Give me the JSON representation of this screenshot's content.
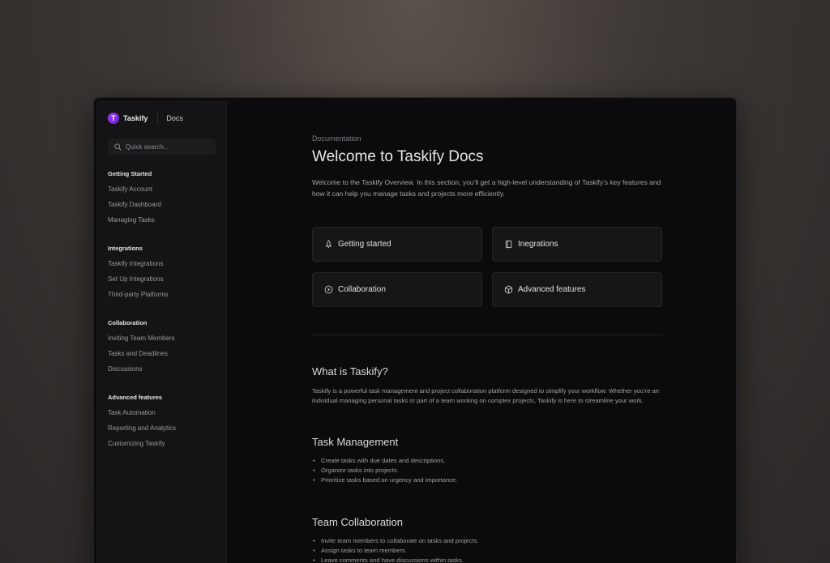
{
  "brand": {
    "name": "Taskify",
    "logo_letter": "T",
    "docs_label": "Docs"
  },
  "search": {
    "placeholder": "Quick search..."
  },
  "sidebar": {
    "groups": [
      {
        "heading": "Getting Started",
        "items": [
          "Taskify Account",
          "Taskify Dashboard",
          "Managing Tasks"
        ]
      },
      {
        "heading": "Integrations",
        "items": [
          "Taskify Integrations",
          "Set Up Integrations",
          "Third-party Platforms"
        ]
      },
      {
        "heading": "Collaboration",
        "items": [
          "Inviting Team Members",
          "Tasks and Deadlines",
          "Discussions"
        ]
      },
      {
        "heading": "Advanced features",
        "items": [
          "Task Automation",
          "Reporting and Analytics",
          "Customizing Taskify"
        ]
      }
    ]
  },
  "main": {
    "eyebrow": "Documentation",
    "title": "Welcome to Taskify Docs",
    "intro": "Welcome to the Taskify Overview. In this section, you’ll get a high-level understanding of Taskify’s key features and how it can help you manage tasks and projects more efficiently.",
    "cards": [
      {
        "label": "Getting started",
        "icon": "rocket-icon"
      },
      {
        "label": "Inegrations",
        "icon": "book-icon"
      },
      {
        "label": "Collaboration",
        "icon": "play-circle-icon"
      },
      {
        "label": "Advanced features",
        "icon": "cube-icon"
      }
    ],
    "sections": [
      {
        "heading": "What is Taskify?",
        "body": "Taskify is a powerful task management and project collaboration platform designed to simplify your workflow. Whether you’re an individual managing personal tasks or part of a team working on complex projects, Taskify is here to streamline your work."
      },
      {
        "heading": "Task Management",
        "items": [
          "Create tasks with due dates and descriptions.",
          "Organize tasks into projects.",
          "Prioritize tasks based on urgency and importance."
        ]
      },
      {
        "heading": "Team Collaboration",
        "items": [
          "Invite team members to collaborate on tasks and projects.",
          "Assign tasks to team members.",
          "Leave comments and have discussions within tasks."
        ]
      }
    ]
  },
  "colors": {
    "accent": "#8b2ee6",
    "background": "#0b0b0d",
    "sidebar": "#141416"
  }
}
